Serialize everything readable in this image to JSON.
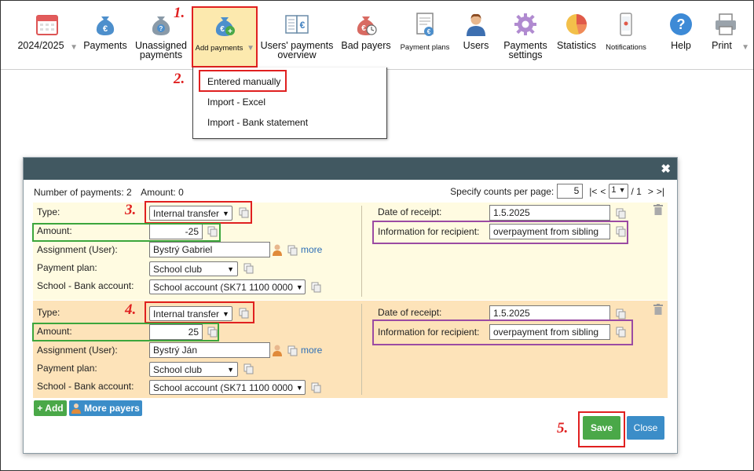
{
  "toolbar": {
    "items": [
      {
        "label": "2024/2025",
        "icon": "calendar-icon"
      },
      {
        "label": "Payments",
        "icon": "money-bag-euro-icon"
      },
      {
        "label": "Unassigned payments",
        "icon": "money-bag-question-icon"
      },
      {
        "label": "Add payments",
        "icon": "money-bag-add-icon"
      },
      {
        "label": "Users' payments overview",
        "icon": "ledger-euro-icon"
      },
      {
        "label": "Bad payers",
        "icon": "money-bag-clock-icon"
      },
      {
        "label": "Payment plans",
        "icon": "document-euro-icon"
      },
      {
        "label": "Users",
        "icon": "user-icon"
      },
      {
        "label": "Payments settings",
        "icon": "gear-icon"
      },
      {
        "label": "Statistics",
        "icon": "pie-chart-icon"
      },
      {
        "label": "Notifications",
        "icon": "phone-icon"
      },
      {
        "label": "Help",
        "icon": "help-icon"
      },
      {
        "label": "Print",
        "icon": "printer-icon"
      }
    ]
  },
  "dropdown": {
    "items": [
      "Entered manually",
      "Import - Excel",
      "Import - Bank statement"
    ]
  },
  "steps": [
    "1.",
    "2.",
    "3.",
    "4.",
    "5."
  ],
  "dialog": {
    "summary": {
      "count_label": "Number of payments: 2",
      "amount_label": "Amount: 0"
    },
    "pager": {
      "label": "Specify counts per page:",
      "per_page": "5",
      "first": "|<",
      "prev": "<",
      "page": "1",
      "of": "/ 1",
      "next": ">",
      "last": ">|"
    },
    "labels": {
      "type": "Type:",
      "amount": "Amount:",
      "assignment": "Assignment (User):",
      "plan": "Payment plan:",
      "school": "School - Bank account:",
      "date": "Date of receipt:",
      "info": "Information for recipient:",
      "more": "more"
    },
    "rows": [
      {
        "type": "Internal transfer",
        "amount": "-25",
        "user": "Bystrý Gabriel",
        "plan": "School club",
        "school": "School account (SK71 1100 0000",
        "date": "1.5.2025",
        "info": "overpayment from sibling"
      },
      {
        "type": "Internal transfer",
        "amount": "25",
        "user": "Bystrý Ján",
        "plan": "School club",
        "school": "School account (SK71 1100 0000",
        "date": "1.5.2025",
        "info": "overpayment from sibling"
      }
    ],
    "buttons": {
      "add": "+ Add",
      "more_payers": "More payers",
      "save": "Save",
      "close": "Close"
    }
  },
  "colors": {
    "accent_red": "#e02020",
    "green": "#4aa848",
    "blue": "#3b8dc8",
    "header": "#415861",
    "row1_bg": "#fffbe1",
    "row2_bg": "#fde3b9"
  }
}
